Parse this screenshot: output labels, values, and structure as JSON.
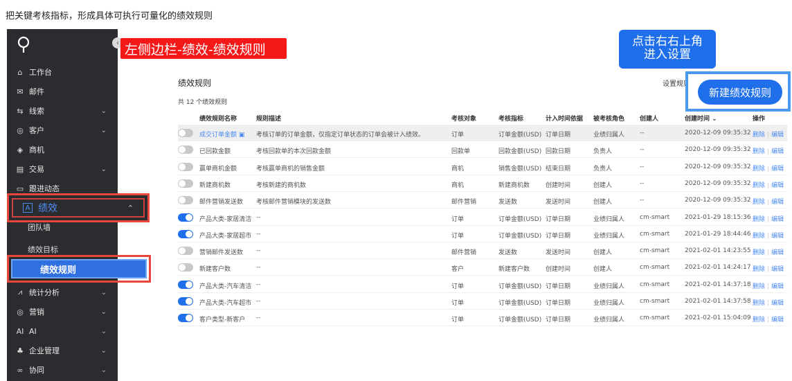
{
  "caption": "把关键考核指标，形成具体可执行可量化的绩效规则",
  "annotations": {
    "left_note": "左侧边栏-绩效-绩效规则",
    "right_note_line1": "点击右右上角",
    "right_note_line2": "进入设置"
  },
  "sidebar": {
    "collapse": "‹",
    "items": [
      {
        "label": "工作台",
        "icon": "home-icon",
        "glyph": "⌂",
        "chev": ""
      },
      {
        "label": "邮件",
        "icon": "mail-icon",
        "glyph": "✉",
        "chev": ""
      },
      {
        "label": "线索",
        "icon": "lead-icon",
        "glyph": "⇆",
        "chev": "⌄"
      },
      {
        "label": "客户",
        "icon": "customer-icon",
        "glyph": "◎",
        "chev": "⌄"
      },
      {
        "label": "商机",
        "icon": "opportunity-icon",
        "glyph": "◈",
        "chev": ""
      },
      {
        "label": "交易",
        "icon": "deal-icon",
        "glyph": "▤",
        "chev": "⌄"
      },
      {
        "label": "跟进动态",
        "icon": "followup-icon",
        "glyph": "▭",
        "chev": ""
      }
    ],
    "performance": {
      "label": "绩效",
      "glyph": "A",
      "chev": "⌃"
    },
    "sub_items": [
      "团队墙",
      "绩效目标",
      "绩效规则"
    ],
    "bottom_items": [
      {
        "label": "统计分析",
        "icon": "chart-icon",
        "glyph": "⩘",
        "chev": "⌄"
      },
      {
        "label": "营销",
        "icon": "marketing-icon",
        "glyph": "◎",
        "chev": "⌄"
      },
      {
        "label": "AI",
        "icon": "ai-icon",
        "glyph": "AI",
        "chev": "⌄"
      },
      {
        "label": "企业管理",
        "icon": "enterprise-icon",
        "glyph": "♣",
        "chev": "⌄"
      },
      {
        "label": "协同",
        "icon": "collab-icon",
        "glyph": "∞",
        "chev": "⌄"
      }
    ]
  },
  "main": {
    "title": "绩效规则",
    "settings_link": "设置规则后",
    "new_button": "新建绩效规则",
    "count": "共 12 个绩效规则",
    "columns": [
      "绩效规则名称",
      "规则描述",
      "考核对象",
      "考核指标",
      "计入时间依据",
      "被考核角色",
      "创建人",
      "创建时间 ⌄",
      "操作"
    ],
    "delete_label": "删除",
    "edit_label": "编辑",
    "rows": [
      {
        "on": false,
        "name": "成交订单金额 ▣",
        "desc": "考核订单的订单金额，仅指定订单状态的订单会被计入绩效。",
        "object": "订单",
        "metric": "订单金额(USD)",
        "basis": "订单日期",
        "role": "业绩归属人",
        "creator": "--",
        "time": "2020-12-09 09:35:32"
      },
      {
        "on": false,
        "name": "已回款金额",
        "desc": "考核回款单的本次回款金额",
        "object": "回款单",
        "metric": "回款金额(USD)",
        "basis": "回款日期",
        "role": "负责人",
        "creator": "--",
        "time": "2020-12-09 09:35:32"
      },
      {
        "on": false,
        "name": "赢单商机金额",
        "desc": "考核赢单商机的销售金额",
        "object": "商机",
        "metric": "销售金额(USD)",
        "basis": "结束日期",
        "role": "负责人",
        "creator": "--",
        "time": "2020-12-09 09:35:32"
      },
      {
        "on": false,
        "name": "新建商机数",
        "desc": "考核新建的商机数",
        "object": "商机",
        "metric": "新建商机数",
        "basis": "创建时间",
        "role": "创建人",
        "creator": "--",
        "time": "2020-12-09 09:35:32"
      },
      {
        "on": false,
        "name": "邮件营销发送数",
        "desc": "考核邮件营销模块的发送数",
        "object": "邮件营销",
        "metric": "发送数",
        "basis": "发送时间",
        "role": "创建人",
        "creator": "--",
        "time": "2020-12-09 09:35:32"
      },
      {
        "on": true,
        "name": "产品大类-家居清洁",
        "desc": "--",
        "object": "订单",
        "metric": "订单金额(USD)",
        "basis": "订单日期",
        "role": "业绩归属人",
        "creator": "cm-smart",
        "time": "2021-01-29 18:15:36"
      },
      {
        "on": true,
        "name": "产品大类-家居超市",
        "desc": "--",
        "object": "订单",
        "metric": "订单金额(USD)",
        "basis": "订单日期",
        "role": "业绩归属人",
        "creator": "cm-smart",
        "time": "2021-01-29 18:44:46"
      },
      {
        "on": false,
        "name": "营销邮件发送数",
        "desc": "--",
        "object": "邮件营销",
        "metric": "发送数",
        "basis": "发送时间",
        "role": "创建人",
        "creator": "cm-smart",
        "time": "2021-02-01 14:23:55"
      },
      {
        "on": false,
        "name": "新建客户数",
        "desc": "--",
        "object": "客户",
        "metric": "新建客户数",
        "basis": "创建时间",
        "role": "创建人",
        "creator": "cm-smart",
        "time": "2021-02-01 14:24:17"
      },
      {
        "on": true,
        "name": "产品大类-汽车清洁",
        "desc": "--",
        "object": "订单",
        "metric": "订单金额(USD)",
        "basis": "订单日期",
        "role": "业绩归属人",
        "creator": "cm-smart",
        "time": "2021-02-01 14:37:18"
      },
      {
        "on": true,
        "name": "产品大类-汽车超市",
        "desc": "--",
        "object": "订单",
        "metric": "订单金额(USD)",
        "basis": "订单日期",
        "role": "业绩归属人",
        "creator": "cm-smart",
        "time": "2021-02-01 14:37:58"
      },
      {
        "on": true,
        "name": "客户类型-新客户",
        "desc": "--",
        "object": "订单",
        "metric": "订单金额(USD)",
        "basis": "订单日期",
        "role": "业绩归属人",
        "creator": "cm-smart",
        "time": "2021-02-01 15:04:09"
      }
    ]
  }
}
